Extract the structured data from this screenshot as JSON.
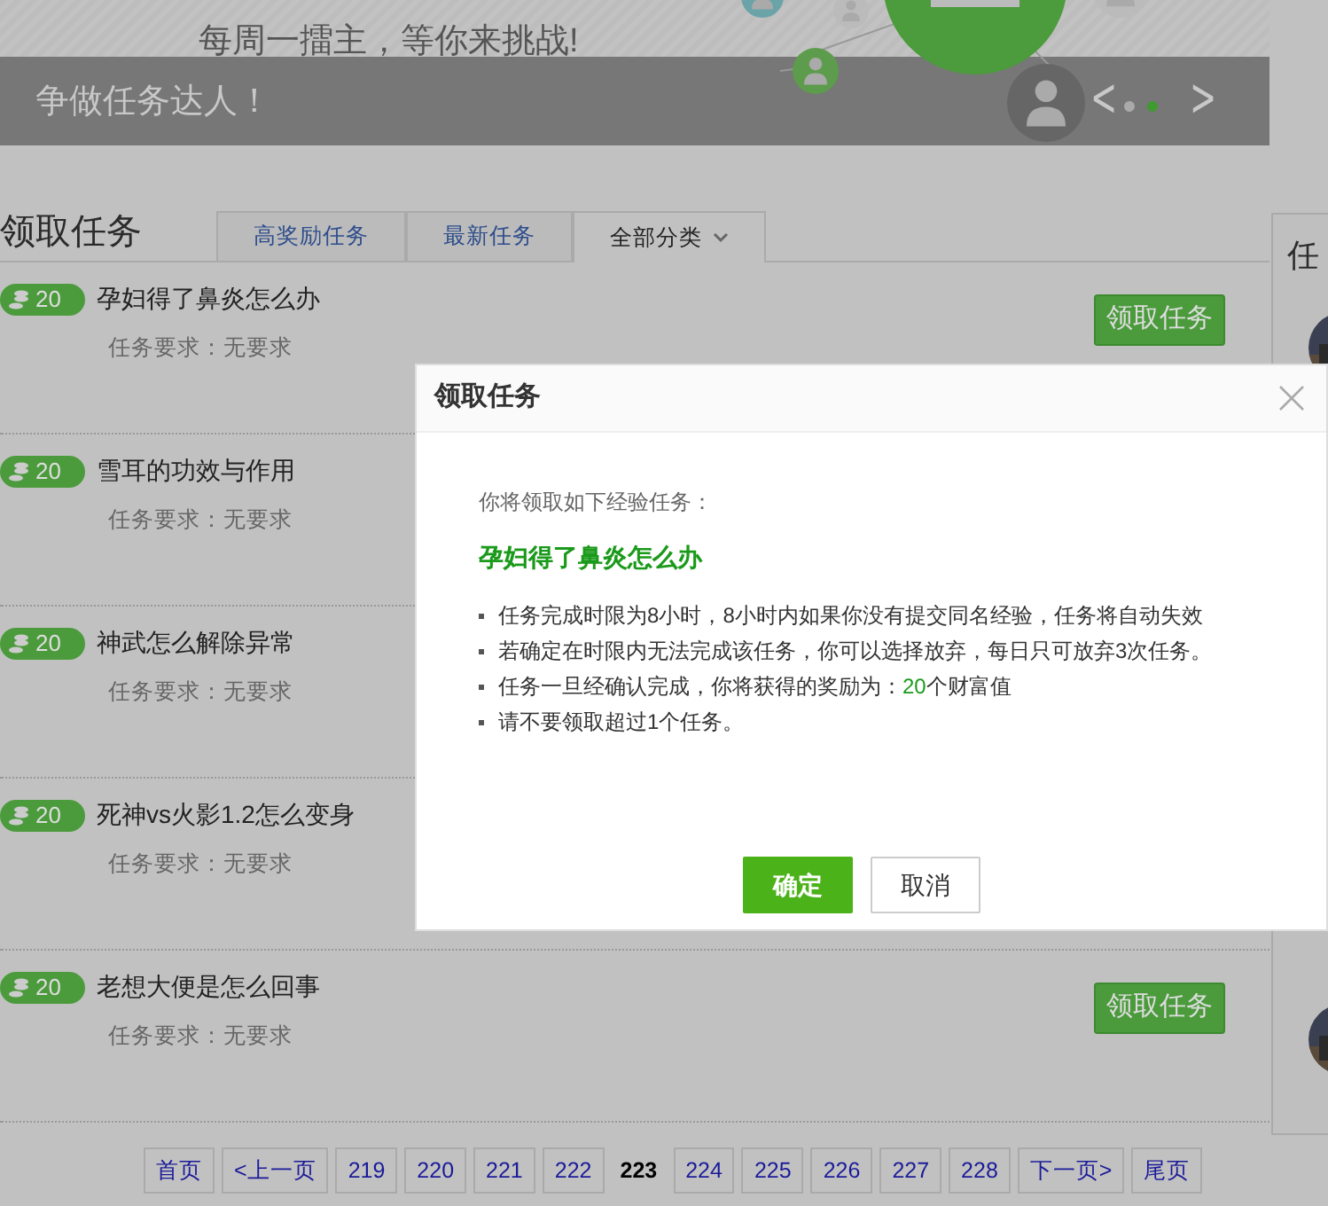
{
  "banner": {
    "subtitle": "每周一擂主，等你来挑战!",
    "title": "争做任务达人！",
    "prev": "<",
    "next": ">",
    "dots": [
      {
        "selected": false
      },
      {
        "selected": true
      }
    ]
  },
  "section": {
    "heading": "领取任务",
    "tabs": [
      {
        "label": "高奖励任务",
        "selected": false,
        "dropdown": false
      },
      {
        "label": "最新任务",
        "selected": false,
        "dropdown": false
      },
      {
        "label": "全部分类",
        "selected": true,
        "dropdown": true
      }
    ]
  },
  "tasks": [
    {
      "reward": "20",
      "title": "孕妇得了鼻炎怎么办",
      "requirement": "任务要求：无要求",
      "action": "领取任务"
    },
    {
      "reward": "20",
      "title": "雪耳的功效与作用",
      "requirement": "任务要求：无要求"
    },
    {
      "reward": "20",
      "title": "神武怎么解除异常",
      "requirement": "任务要求：无要求"
    },
    {
      "reward": "20",
      "title": "死神vs火影1.2怎么变身",
      "requirement": "任务要求：无要求"
    },
    {
      "reward": "20",
      "title": "老想大便是怎么回事",
      "requirement": "任务要求：无要求",
      "action": "领取任务"
    }
  ],
  "sidebar": {
    "title": "任"
  },
  "pagination": [
    {
      "label": "首页",
      "selected": false
    },
    {
      "label": "<上一页",
      "selected": false
    },
    {
      "label": "219",
      "selected": false
    },
    {
      "label": "220",
      "selected": false
    },
    {
      "label": "221",
      "selected": false
    },
    {
      "label": "222",
      "selected": false
    },
    {
      "label": "223",
      "selected": true
    },
    {
      "label": "224",
      "selected": false
    },
    {
      "label": "225",
      "selected": false
    },
    {
      "label": "226",
      "selected": false
    },
    {
      "label": "227",
      "selected": false
    },
    {
      "label": "228",
      "selected": false
    },
    {
      "label": "下一页>",
      "selected": false
    },
    {
      "label": "尾页",
      "selected": false
    }
  ],
  "dialog": {
    "title": "领取任务",
    "intro": "你将领取如下经验任务：",
    "task": "孕妇得了鼻炎怎么办",
    "rules": [
      [
        {
          "text": "任务完成时限为",
          "accent": false
        },
        {
          "text": "8",
          "accent": false
        },
        {
          "text": "小时，",
          "accent": false
        },
        {
          "text": "8",
          "accent": false
        },
        {
          "text": "小时内如果你没有提交同名经验，任务将自动失效",
          "accent": false
        }
      ],
      [
        {
          "text": "若确定在时限内无法完成该任务，你可以选择放弃，每日只可放弃3次任务。",
          "accent": false
        }
      ],
      [
        {
          "text": "任务一旦经确认完成，你将获得的奖励为：",
          "accent": false
        },
        {
          "text": "20",
          "accent": true
        },
        {
          "text": "个财富值",
          "accent": false
        }
      ],
      [
        {
          "text": "请不要领取超过1个任务。",
          "accent": false
        }
      ]
    ],
    "confirm": "确定",
    "cancel": "取消"
  }
}
